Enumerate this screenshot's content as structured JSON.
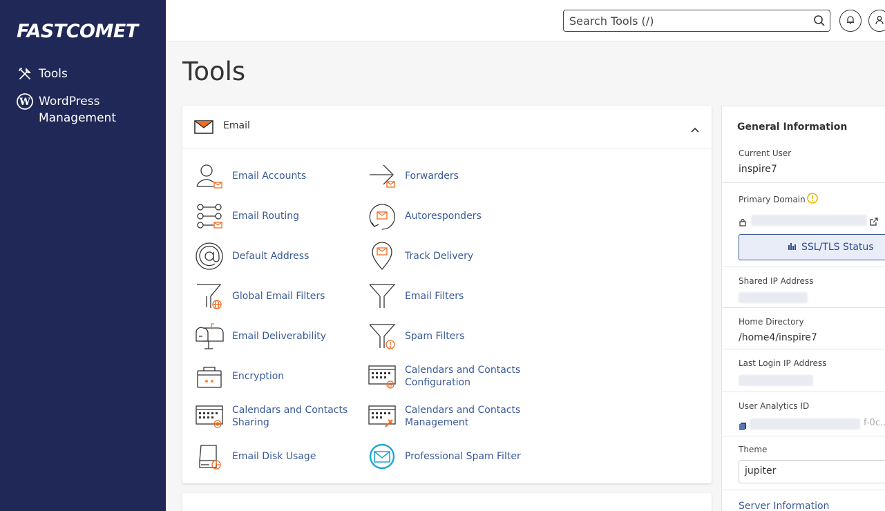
{
  "sidebar": {
    "logo": "FASTCOMET",
    "items": [
      {
        "label": "Tools",
        "icon": "tools-icon"
      },
      {
        "label": "WordPress Management",
        "icon": "wordpress-icon"
      }
    ]
  },
  "topbar": {
    "search_placeholder": "Search Tools (/)",
    "search_icon": "search-icon",
    "notifications_icon": "bell-icon",
    "user_icon": "user-icon"
  },
  "page": {
    "title": "Tools"
  },
  "email_panel": {
    "title": "Email",
    "tools_col1": [
      {
        "label": "Email Accounts"
      },
      {
        "label": "Email Routing"
      },
      {
        "label": "Default Address"
      },
      {
        "label": "Global Email Filters"
      },
      {
        "label": "Email Deliverability"
      },
      {
        "label": "Encryption"
      },
      {
        "label_line1": "Calendars and Contacts",
        "label_line2": "Sharing"
      },
      {
        "label": "Email Disk Usage"
      }
    ],
    "tools_col2": [
      {
        "label": "Forwarders"
      },
      {
        "label": "Autoresponders"
      },
      {
        "label": "Track Delivery"
      },
      {
        "label": "Email Filters"
      },
      {
        "label": "Spam Filters"
      },
      {
        "label_line1": "Calendars and Contacts",
        "label_line2": "Configuration"
      },
      {
        "label_line1": "Calendars and Contacts",
        "label_line2": "Management"
      },
      {
        "label": "Professional Spam Filter"
      }
    ]
  },
  "general_info": {
    "title": "General Information",
    "current_user_label": "Current User",
    "current_user": "inspire7",
    "primary_domain_label": "Primary Domain",
    "ssl_button": "SSL/TLS Status",
    "shared_ip_label": "Shared IP Address",
    "home_dir_label": "Home Directory",
    "home_dir": "/home4/inspire7",
    "last_login_label": "Last Login IP Address",
    "analytics_label": "User Analytics ID",
    "analytics_suffix": "f-0c..",
    "theme_label": "Theme",
    "theme_value": "jupiter",
    "server_info_link": "Server Information"
  },
  "colors": {
    "sidebar_bg": "#1f2857",
    "link": "#3a5a98",
    "accent_orange": "#f26b21",
    "spam_filter_blue": "#1ea6d4"
  }
}
